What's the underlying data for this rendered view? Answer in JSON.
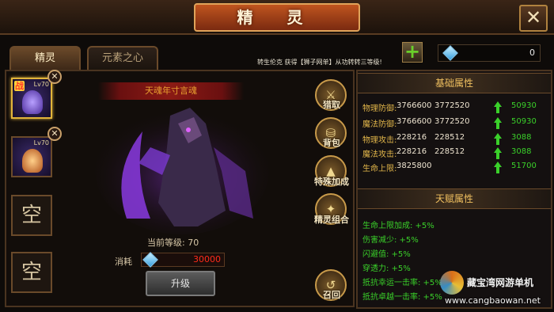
{
  "header": {
    "title": "精 灵",
    "close_icon": "close-icon"
  },
  "tabs": [
    {
      "label": "精灵",
      "active": true
    },
    {
      "label": "元素之心",
      "active": false
    }
  ],
  "notice": "转生伦克 获得【狮子网单】从功转转三等级!",
  "currency": {
    "icon": "gem-icon",
    "value": "0",
    "add_icon": "plus-icon"
  },
  "pet_slots": [
    {
      "battle_tag": "战",
      "level": "Lv70",
      "selected": true
    },
    {
      "battle_tag": "",
      "level": "Lv70",
      "selected": false
    },
    {
      "empty_label": "空"
    },
    {
      "empty_label": "空"
    }
  ],
  "pet_name": "天魂年寸言魂",
  "side_actions": [
    {
      "label": "猎取",
      "icon": "crossbow-icon"
    },
    {
      "label": "背包",
      "icon": "bag-icon"
    },
    {
      "label": "特殊加成",
      "icon": "arrow-up-icon"
    },
    {
      "label": "精灵组合",
      "icon": "combo-icon"
    },
    {
      "label": "召回",
      "icon": "recall-icon"
    }
  ],
  "current_level": "当前等级: 70",
  "cost": {
    "label": "消耗",
    "value": "30000"
  },
  "upgrade_label": "升级",
  "base_stats": {
    "title": "基础属性",
    "rows": [
      {
        "name": "物理防御:",
        "v1": "3766600",
        "v2": "3772520",
        "gain": "50930"
      },
      {
        "name": "魔法防御:",
        "v1": "3766600",
        "v2": "3772520",
        "gain": "50930"
      },
      {
        "name": "物理攻击:",
        "v1": "228216",
        "v2": "228512",
        "gain": "3088"
      },
      {
        "name": "魔法攻击:",
        "v1": "228216",
        "v2": "228512",
        "gain": "3088"
      },
      {
        "name": "生命上限:",
        "v1": "3825800",
        "v2": "",
        "gain": "51700"
      }
    ]
  },
  "talent_stats": {
    "title": "天赋属性",
    "rows": [
      "生命上限加成: +5%",
      "伤害减少: +5%",
      "闪避值: +5%",
      "穿透力: +5%",
      "抵抗幸运一击率: +5%",
      "抵抗卓越一击率: +5%"
    ]
  },
  "watermark": {
    "line1": "藏宝湾网游单机",
    "line2": "www.cangbaowan.net"
  },
  "colors": {
    "accent": "#e2b43a",
    "positive": "#3ad02a",
    "cost": "#ff2a1a",
    "title_plate": "#c0551f"
  }
}
